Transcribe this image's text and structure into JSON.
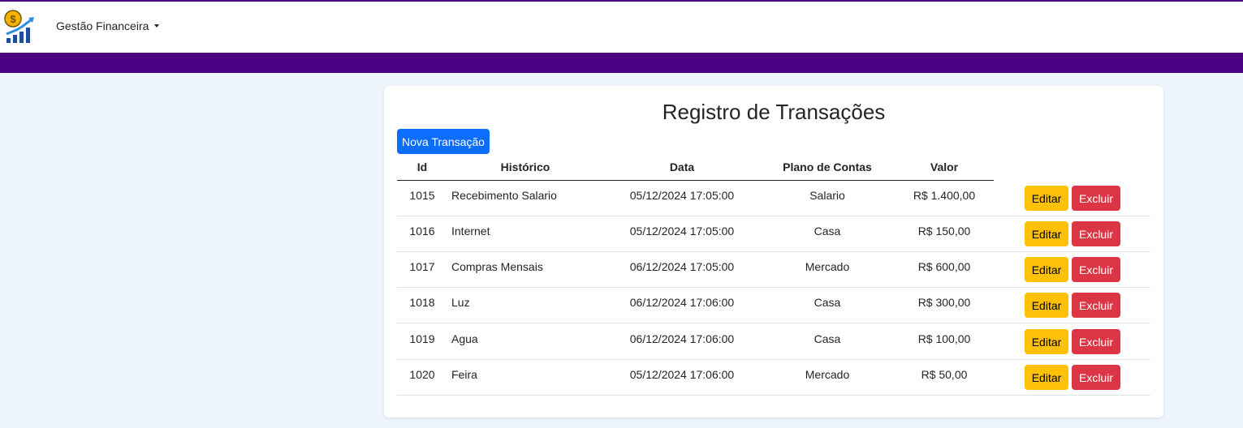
{
  "navbar": {
    "brand_label": "Gestão Financeira",
    "logo_icon": "money-growth-chart-icon",
    "accent_color": "#4b0082"
  },
  "card": {
    "title": "Registro de Transações",
    "new_button_label": "Nova Transação"
  },
  "table": {
    "columns": [
      "Id",
      "Histórico",
      "Data",
      "Plano de Contas",
      "Valor"
    ],
    "edit_label": "Editar",
    "delete_label": "Excluir",
    "rows": [
      {
        "id": "1015",
        "historico": "Recebimento Salario",
        "data": "05/12/2024 17:05:00",
        "plano": "Salario",
        "valor": "R$ 1.400,00"
      },
      {
        "id": "1016",
        "historico": "Internet",
        "data": "05/12/2024 17:05:00",
        "plano": "Casa",
        "valor": "R$ 150,00"
      },
      {
        "id": "1017",
        "historico": "Compras Mensais",
        "data": "06/12/2024 17:05:00",
        "plano": "Mercado",
        "valor": "R$ 600,00"
      },
      {
        "id": "1018",
        "historico": "Luz",
        "data": "06/12/2024 17:06:00",
        "plano": "Casa",
        "valor": "R$ 300,00"
      },
      {
        "id": "1019",
        "historico": "Agua",
        "data": "06/12/2024 17:06:00",
        "plano": "Casa",
        "valor": "R$ 100,00"
      },
      {
        "id": "1020",
        "historico": "Feira",
        "data": "05/12/2024 17:06:00",
        "plano": "Mercado",
        "valor": "R$ 50,00"
      }
    ]
  },
  "colors": {
    "primary": "#0d6efd",
    "warning": "#ffc107",
    "danger": "#dc3545",
    "page_background": "#eef5fd"
  }
}
